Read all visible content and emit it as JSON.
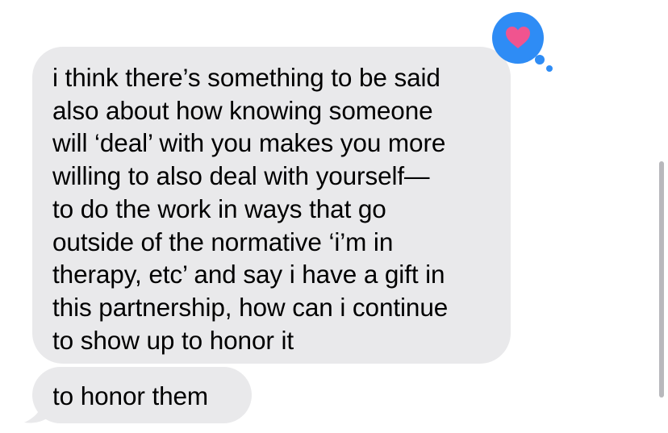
{
  "conversation": {
    "messages": [
      {
        "text": "i think there’s something to be said\nalso about how knowing someone\nwill ‘deal’ with you makes you more\nwilling to also deal with yourself—\nto do the work in ways that go\noutside of the normative ‘i’m in\ntherapy, etc’ and say i have a gift in\nthis partnership, how can i continue\nto show up to honor it",
        "reaction": "heart-icon"
      },
      {
        "text": "to honor them"
      }
    ]
  },
  "colors": {
    "bubble_gray": "#e9e9eb",
    "reaction_blue": "#2e8cf5",
    "heart_pink": "#f0548f"
  }
}
